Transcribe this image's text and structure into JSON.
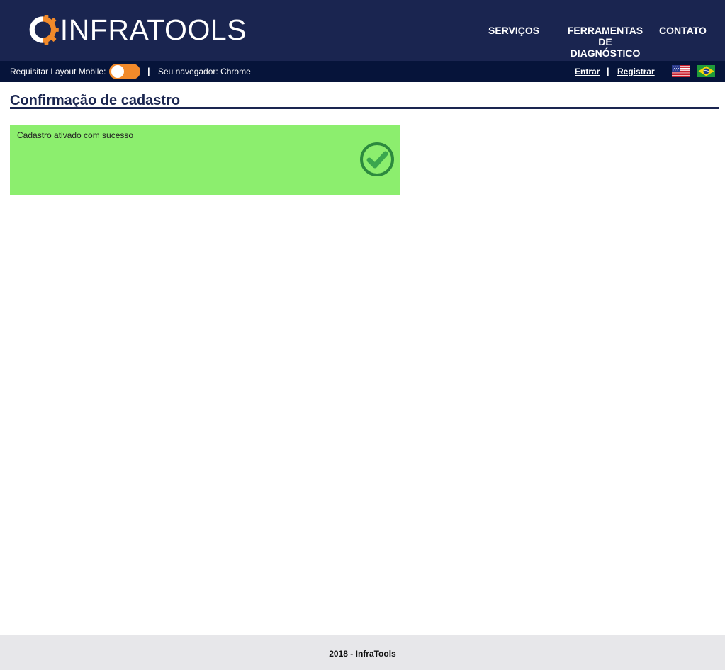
{
  "header": {
    "logo_text": "INFRATOOLS",
    "nav": {
      "servicos": "SERVIÇOS",
      "ferramentas": "FERRAMENTAS DE DIAGNÓSTICO",
      "contato": "CONTATO"
    }
  },
  "subbar": {
    "mobile_label": "Requisitar Layout Mobile:",
    "separator": "|",
    "browser_label": "Seu navegador: Chrome",
    "entrar": "Entrar",
    "registrar": "Registrar"
  },
  "main": {
    "title": "Confirmação de cadastro",
    "message": "Cadastro ativado com sucesso"
  },
  "footer": {
    "text": "2018 - InfraTools"
  },
  "colors": {
    "header_bg": "#1a2550",
    "subbar_bg": "#06143a",
    "accent_orange": "#f28a2a",
    "success_bg": "#8cee6e",
    "success_icon": "#2c8a3e",
    "footer_bg": "#e7e7ea"
  },
  "icons": {
    "logo": "gear-logo-icon",
    "toggle": "toggle-switch",
    "flag_us": "us-flag-icon",
    "flag_br": "brazil-flag-icon",
    "success": "check-circle-icon"
  }
}
